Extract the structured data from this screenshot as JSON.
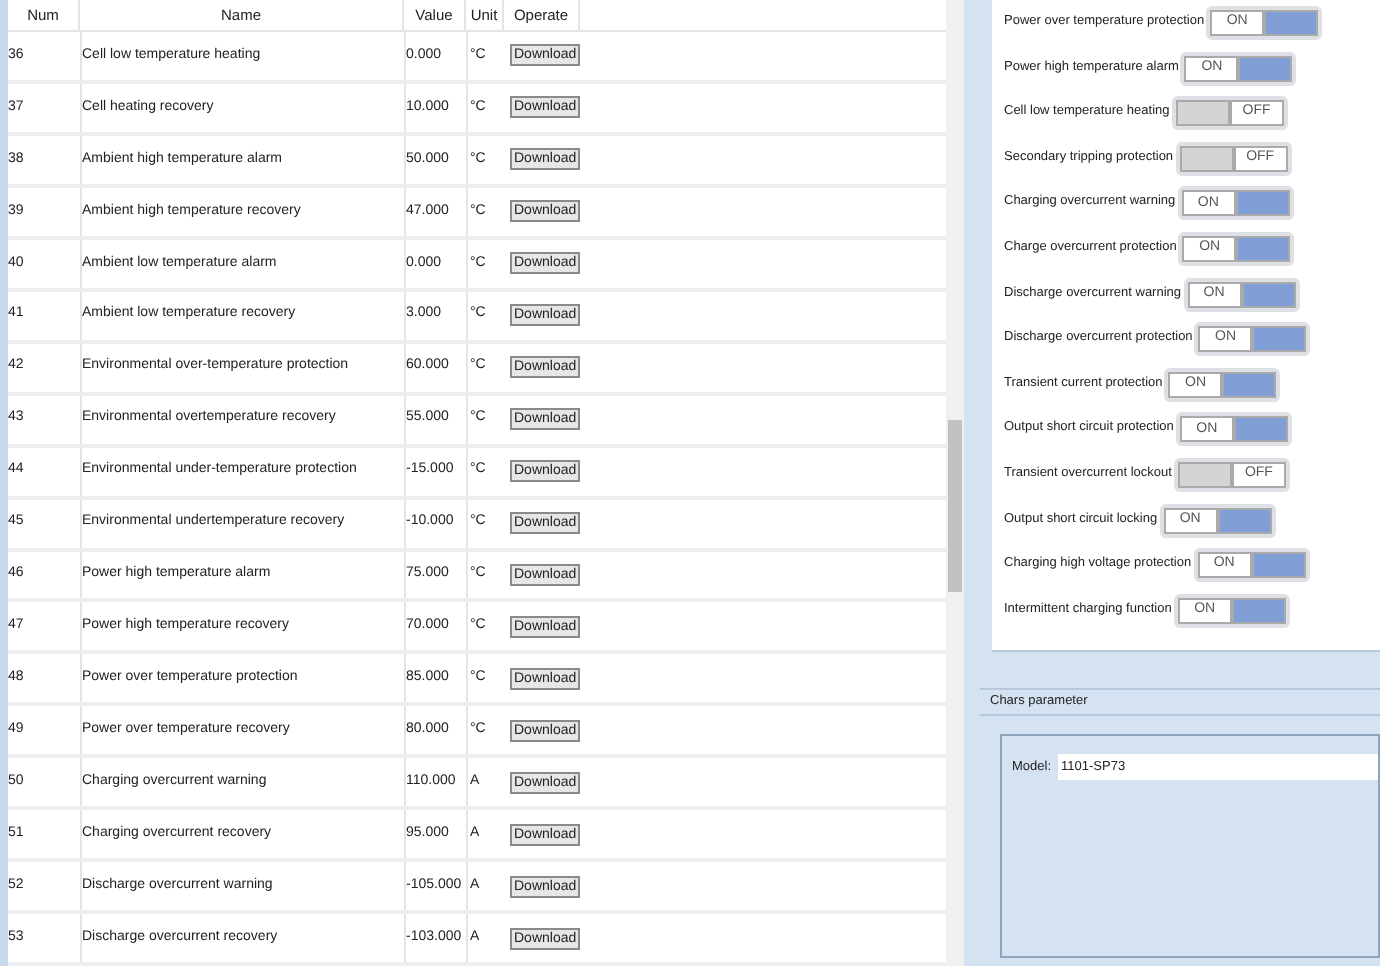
{
  "table": {
    "columns": [
      "Num",
      "Name",
      "Value",
      "Unit",
      "Operate"
    ],
    "rows": [
      {
        "num": "36",
        "name": "Cell low temperature heating",
        "value": "0.000",
        "unit": "°C",
        "operate": "Download"
      },
      {
        "num": "37",
        "name": "Cell heating recovery",
        "value": "10.000",
        "unit": "°C",
        "operate": "Download"
      },
      {
        "num": "38",
        "name": "Ambient high temperature alarm",
        "value": "50.000",
        "unit": "°C",
        "operate": "Download"
      },
      {
        "num": "39",
        "name": "Ambient high temperature recovery",
        "value": "47.000",
        "unit": "°C",
        "operate": "Download"
      },
      {
        "num": "40",
        "name": "Ambient low temperature alarm",
        "value": "0.000",
        "unit": "°C",
        "operate": "Download"
      },
      {
        "num": "41",
        "name": "Ambient low temperature recovery",
        "value": "3.000",
        "unit": "°C",
        "operate": "Download"
      },
      {
        "num": "42",
        "name": "Environmental over-temperature protection",
        "value": "60.000",
        "unit": "°C",
        "operate": "Download"
      },
      {
        "num": "43",
        "name": "Environmental overtemperature recovery",
        "value": "55.000",
        "unit": "°C",
        "operate": "Download"
      },
      {
        "num": "44",
        "name": "Environmental under-temperature protection",
        "value": "-15.000",
        "unit": "°C",
        "operate": "Download"
      },
      {
        "num": "45",
        "name": "Environmental undertemperature recovery",
        "value": "-10.000",
        "unit": "°C",
        "operate": "Download"
      },
      {
        "num": "46",
        "name": "Power high temperature alarm",
        "value": "75.000",
        "unit": "°C",
        "operate": "Download"
      },
      {
        "num": "47",
        "name": "Power high temperature recovery",
        "value": "70.000",
        "unit": "°C",
        "operate": "Download"
      },
      {
        "num": "48",
        "name": "Power over temperature protection",
        "value": "85.000",
        "unit": "°C",
        "operate": "Download"
      },
      {
        "num": "49",
        "name": "Power over temperature recovery",
        "value": "80.000",
        "unit": "°C",
        "operate": "Download"
      },
      {
        "num": "50",
        "name": "Charging overcurrent warning",
        "value": "110.000",
        "unit": "A",
        "operate": "Download"
      },
      {
        "num": "51",
        "name": "Charging overcurrent recovery",
        "value": "95.000",
        "unit": "A",
        "operate": "Download"
      },
      {
        "num": "52",
        "name": "Discharge overcurrent warning",
        "value": "-105.000",
        "unit": "A",
        "operate": "Download"
      },
      {
        "num": "53",
        "name": "Discharge overcurrent recovery",
        "value": "-103.000",
        "unit": "A",
        "operate": "Download"
      }
    ]
  },
  "switches": [
    {
      "label": "Power over temperature protection",
      "on": true,
      "state_text": "ON"
    },
    {
      "label": "Power high temperature alarm",
      "on": true,
      "state_text": "ON"
    },
    {
      "label": "Cell low temperature heating",
      "on": false,
      "state_text": "OFF"
    },
    {
      "label": "Secondary tripping protection",
      "on": false,
      "state_text": "OFF"
    },
    {
      "label": "Charging overcurrent warning",
      "on": true,
      "state_text": "ON"
    },
    {
      "label": "Charge overcurrent protection",
      "on": true,
      "state_text": "ON"
    },
    {
      "label": "Discharge overcurrent warning",
      "on": true,
      "state_text": "ON"
    },
    {
      "label": "Discharge overcurrent protection",
      "on": true,
      "state_text": "ON"
    },
    {
      "label": "Transient current protection",
      "on": true,
      "state_text": "ON"
    },
    {
      "label": "Output short circuit protection",
      "on": true,
      "state_text": "ON"
    },
    {
      "label": "Transient overcurrent lockout",
      "on": false,
      "state_text": "OFF"
    },
    {
      "label": "Output short circuit locking",
      "on": true,
      "state_text": "ON"
    },
    {
      "label": "Charging high voltage protection",
      "on": true,
      "state_text": "ON"
    },
    {
      "label": "Intermittent charging function",
      "on": true,
      "state_text": "ON"
    }
  ],
  "chars_parameter": {
    "title": "Chars parameter",
    "model_label": "Model:",
    "model_value": "1101-SP73"
  }
}
